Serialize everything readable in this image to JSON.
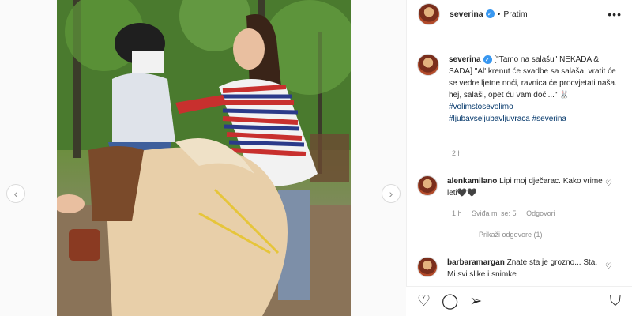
{
  "post": {
    "username": "severina",
    "follow_status": "Pratim",
    "caption_user": "severina",
    "caption_text": "[\"Tamo na salašu\" NEKADA & SADA] \"Al' krenut će svadbe sa salaša, vratit će se vedre ljetne noći, ravnica će procvjetati naša. hej, salaši, opet ću vam doći...\" 🐰",
    "hashtags": [
      "#volimstosevolimo",
      "#ljubavseljubavljuvraca",
      "#severina"
    ],
    "caption_time": "2 h"
  },
  "comments": [
    {
      "user": "alenkamilano",
      "text": "Lipi moj dječarac. Kako vrime leti🖤🖤",
      "time": "1 h",
      "likes": "Sviđa mi se: 5",
      "reply": "Odgovori",
      "view_replies": "Prikaži odgovore (1)"
    },
    {
      "user": "barbaramargan",
      "text": "Znate sta je grozno... Sta. Mi svi slike i snimke"
    }
  ],
  "icons": {
    "prev": "chevron-left-icon",
    "next": "chevron-right-icon",
    "more": "more-icon",
    "like": "heart-icon",
    "comment": "comment-icon",
    "share": "share-icon",
    "save": "bookmark-icon"
  },
  "colors": {
    "link": "#003569",
    "verified": "#3897f0",
    "muted": "#8e8e8e"
  }
}
